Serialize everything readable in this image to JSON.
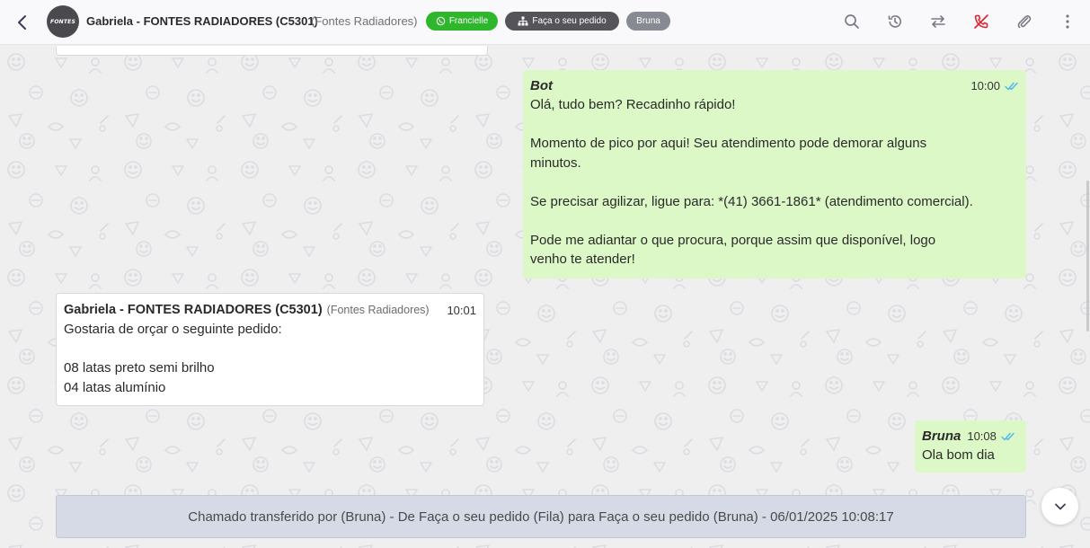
{
  "header": {
    "avatar_text": "FONTES",
    "contact_name": "Gabriela - FONTES RADIADORES (C5301)",
    "contact_company": "(Fontes Radiadores)",
    "badges": [
      {
        "label": "Francielle",
        "icon": "whatsapp-icon",
        "color": "#2eb72c"
      },
      {
        "label": "Faça o seu pedido",
        "icon": "sitemap-icon",
        "color": "#555559"
      },
      {
        "label": "Bruna",
        "icon": "",
        "color": "#878a92"
      }
    ],
    "actions": [
      "search-icon",
      "history-icon",
      "transfer-icon",
      "end-call-icon",
      "attachment-icon",
      "more-icon"
    ]
  },
  "messages": [
    {
      "direction": "out",
      "sender": "Bot",
      "time": "10:00",
      "lines": [
        "Olá, tudo bem? Recadinho rápido!",
        "",
        "Momento de pico por aqui! Seu atendimento pode demorar alguns",
        "minutos.",
        "",
        "Se precisar agilizar, ligue para: *(41) 3661-1861* (atendimento comercial).",
        "",
        "Pode me adiantar o que procura, porque assim que disponível, logo",
        "venho te atender!"
      ]
    },
    {
      "direction": "in",
      "sender": "Gabriela - FONTES RADIADORES (C5301)",
      "sender_company": "(Fontes Radiadores)",
      "time": "10:01",
      "lines": [
        "Gostaria de orçar o seguinte pedido:",
        "",
        "08 latas preto semi brilho",
        "04 latas alumínio"
      ]
    },
    {
      "direction": "out",
      "sender": "Bruna",
      "time": "10:08",
      "lines": [
        "Ola bom dia"
      ]
    }
  ],
  "banner": "Chamado transferido por (Bruna) - De Faça o seu pedido (Fila) para Faça o seu pedido (Bruna) - 06/01/2025 10:08:17",
  "colors": {
    "out_bubble": "#dcf8c6",
    "in_bubble": "#ffffff",
    "ticks": "#4fb6ec",
    "banner": "#d6dae6"
  }
}
